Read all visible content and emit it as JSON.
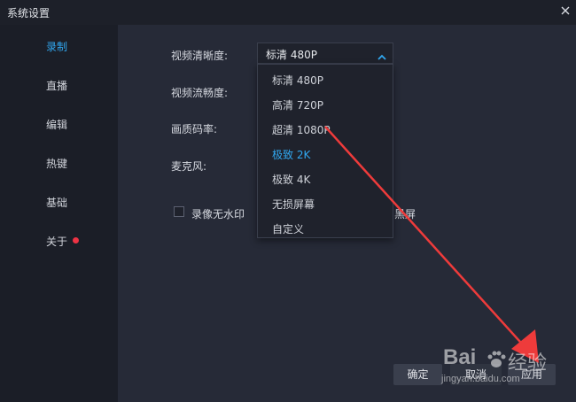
{
  "window": {
    "title": "系统设置"
  },
  "sidebar": {
    "items": [
      {
        "label": "录制",
        "active": true
      },
      {
        "label": "直播"
      },
      {
        "label": "编辑"
      },
      {
        "label": "热键"
      },
      {
        "label": "基础"
      },
      {
        "label": "关于",
        "badge": true
      }
    ]
  },
  "settings": {
    "quality_label": "视频清晰度:",
    "fluency_label": "视频流畅度:",
    "bitrate_label": "画质码率:",
    "mic_label": "麦克风:",
    "watermark_label": "录像无水印",
    "partial_text": "黑屏"
  },
  "select": {
    "value": "标清 480P",
    "options": [
      "标清 480P",
      "高清 720P",
      "超清 1080P",
      "极致 2K",
      "极致 4K",
      "无损屏幕",
      "自定义"
    ],
    "highlighted_index": 3
  },
  "footer": {
    "confirm": "确定",
    "cancel": "取消",
    "apply": "应用"
  },
  "watermark": {
    "brand": "Bai",
    "sub": "经验",
    "url": "jingyan.baidu.com"
  },
  "colors": {
    "accent": "#31a8f0",
    "arrow": "#ee3b3b",
    "badge": "#ee3344"
  },
  "icons": {
    "close": "close-icon",
    "chevron": "chevron-up-icon",
    "arrow": "red-arrow-annotation"
  }
}
